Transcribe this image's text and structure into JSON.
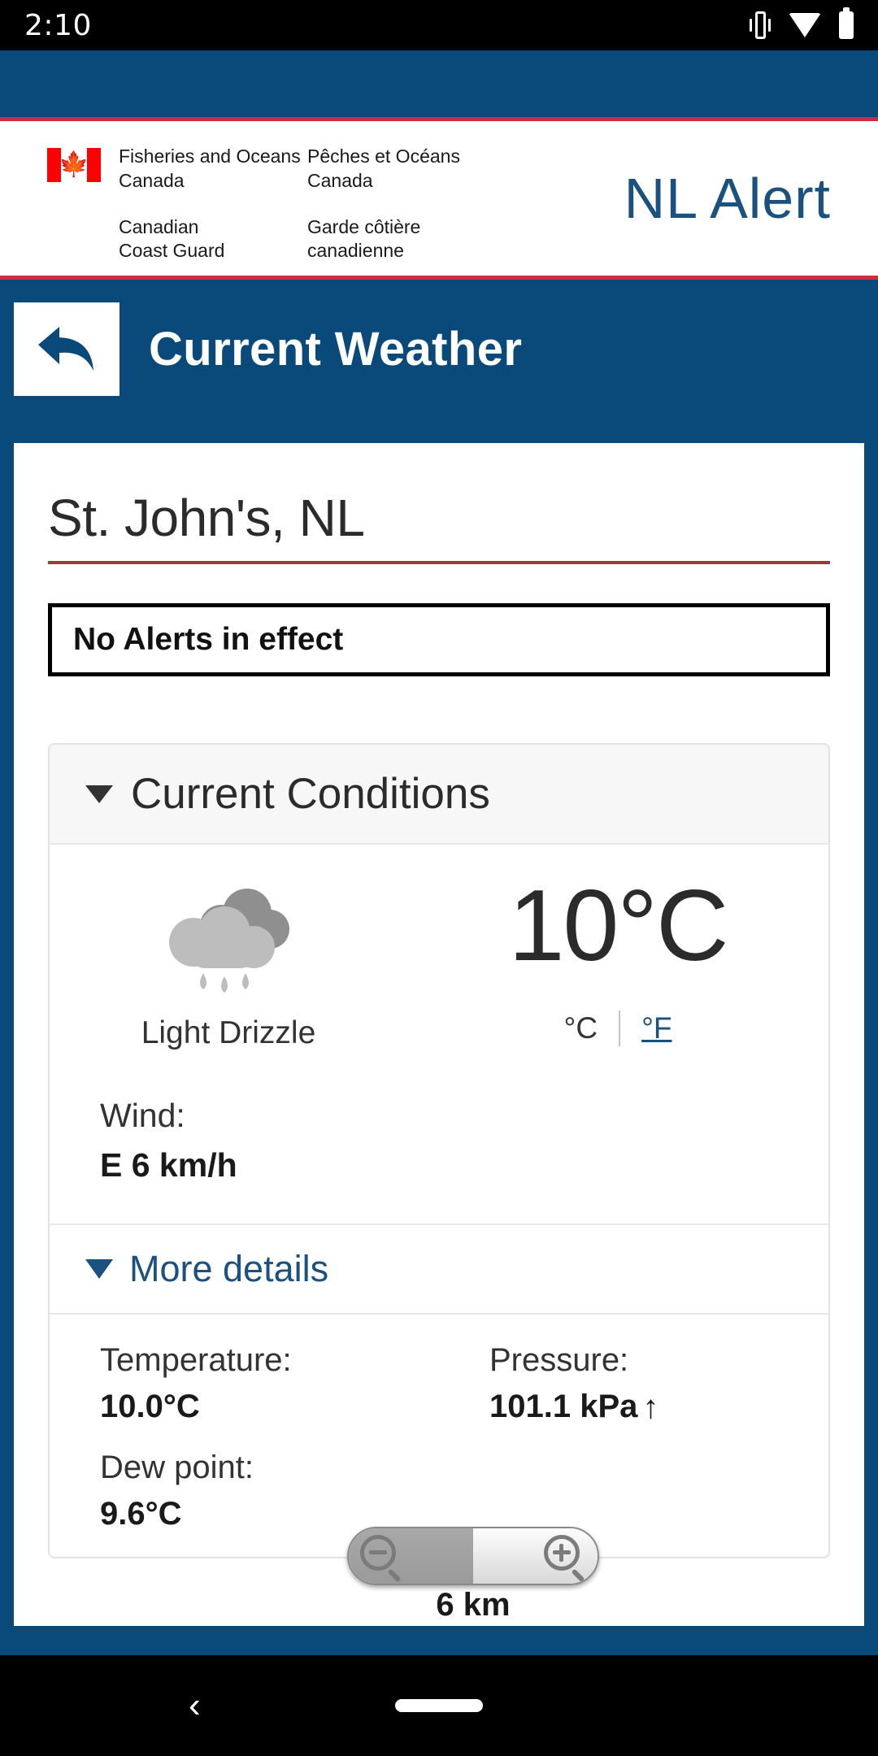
{
  "statusbar": {
    "time": "2:10",
    "icons": [
      "vibrate-icon",
      "wifi-icon",
      "battery-icon"
    ]
  },
  "goc_signature": {
    "flag_icon": "canada-flag-icon",
    "en_dept": "Fisheries and Oceans",
    "en_dept2": "Canada",
    "fr_dept": "Pêches et Océans",
    "fr_dept2": "Canada",
    "en_cg": "Canadian",
    "en_cg2": "Coast Guard",
    "fr_cg": "Garde côtière",
    "fr_cg2": "canadienne",
    "app_logo": "NL Alert"
  },
  "titlebar": {
    "back_icon": "back-arrow-icon",
    "title": "Current Weather"
  },
  "location": {
    "name": "St. John's, NL"
  },
  "alerts": {
    "message": "No Alerts in effect"
  },
  "current_conditions": {
    "section_title": "Current Conditions",
    "caret_icon": "caret-down-icon",
    "weather_icon": "drizzle-cloud-icon",
    "condition": "Light Drizzle",
    "temperature": "10°C",
    "unit_celsius": "°C",
    "unit_fahrenheit": "°F",
    "wind_label": "Wind:",
    "wind_value": "E 6 km/h",
    "more_details_label": "More details",
    "more_details_icon": "caret-down-icon",
    "details": [
      {
        "label": "Temperature:",
        "value": "10.0°C",
        "trend": ""
      },
      {
        "label": "Pressure:",
        "value": "101.1 kPa",
        "trend": "↑"
      },
      {
        "label": "Dew point:",
        "value": "9.6°C",
        "trend": ""
      }
    ]
  },
  "zoom_control": {
    "zoom_out_icon": "magnifier-minus-icon",
    "zoom_in_icon": "magnifier-plus-icon",
    "visibility_value": "6 km"
  },
  "navbar": {
    "back_icon": "nav-back-icon",
    "home_pill": "nav-home-pill"
  },
  "colors": {
    "brand_blue": "#0a4a7a",
    "accent_red": "#c9303c",
    "link_blue": "#1a5180",
    "rule_red": "#9c3a3a"
  }
}
